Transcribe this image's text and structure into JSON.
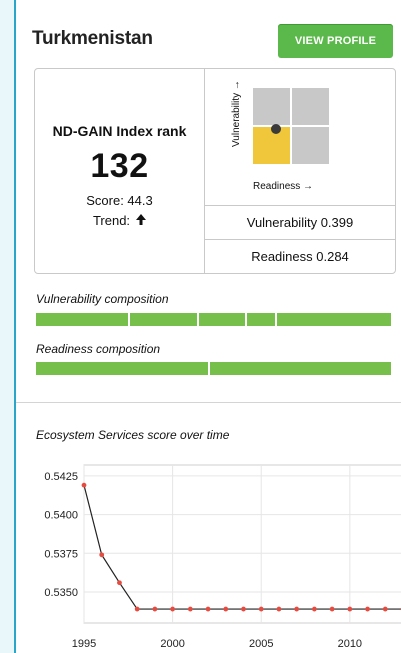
{
  "header": {
    "country": "Turkmenistan",
    "view_profile_label": "VIEW PROFILE"
  },
  "index": {
    "title": "ND-GAIN Index rank",
    "rank": "132",
    "score_text": "Score: 44.3",
    "trend_label": "Trend:",
    "trend_icon": "arrow-up-icon"
  },
  "matrix": {
    "vulnerability_axis": "Vulnerability →",
    "readiness_axis": "Readiness →",
    "colors": {
      "grey": "#c8c8c8",
      "highlight": "#f0c63a",
      "dot": "#3a3a3a"
    },
    "highlight_quadrant": "bottom-left"
  },
  "metrics": {
    "vulnerability_text": "Vulnerability 0.399",
    "readiness_text": "Readiness 0.284"
  },
  "composition": {
    "vulnerability_label": "Vulnerability composition",
    "vulnerability_segments": [
      26.5,
      19.5,
      13.5,
      8.5,
      32
    ],
    "readiness_label": "Readiness composition",
    "readiness_segments": [
      49,
      51
    ],
    "bar_color": "#76bf4b"
  },
  "chart_data": {
    "type": "line",
    "title": "Ecosystem Services score over time",
    "x": [
      1995,
      1996,
      1997,
      1998,
      1999,
      2000,
      2001,
      2002,
      2003,
      2004,
      2005,
      2006,
      2007,
      2008,
      2009,
      2010,
      2011,
      2012,
      2013
    ],
    "y": [
      0.5419,
      0.5374,
      0.5356,
      0.5339,
      0.5339,
      0.5339,
      0.5339,
      0.5339,
      0.5339,
      0.5339,
      0.5339,
      0.5339,
      0.5339,
      0.5339,
      0.5339,
      0.5339,
      0.5339,
      0.5339,
      0.5339
    ],
    "x_ticks": [
      "1995",
      "2000",
      "2005",
      "2010"
    ],
    "y_ticks": [
      "0.5425",
      "0.5400",
      "0.5375",
      "0.5350"
    ],
    "xlim": [
      1995,
      2013
    ],
    "ylim": [
      0.533,
      0.5432
    ],
    "line_color": "#222222",
    "point_color": "#e84a3f",
    "grid": true
  }
}
